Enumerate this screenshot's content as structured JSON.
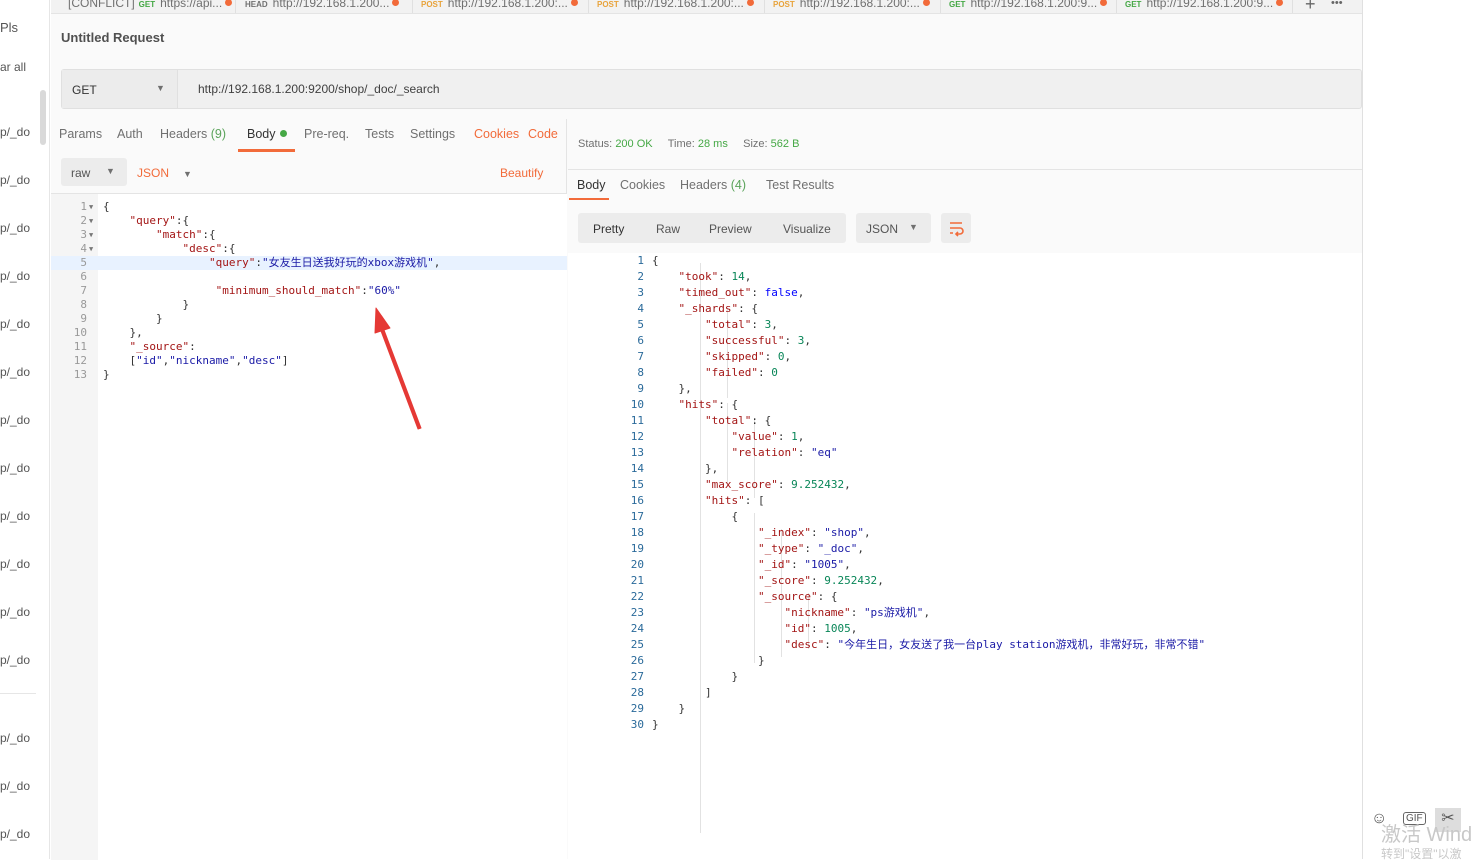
{
  "sidebar": {
    "top_text": "Pls",
    "clear_all": "ar all",
    "items": [
      "p/_do",
      "p/_do",
      "p/_do",
      "p/_do",
      "p/_do",
      "p/_do",
      "p/_do",
      "p/_do",
      "p/_do",
      "p/_do",
      "p/_do",
      "p/_do",
      "p/_do",
      "p/_do",
      "p/_do"
    ]
  },
  "tabs": [
    {
      "prefix": "[CONFLICT]",
      "method": "GET",
      "method_color": "#45a845",
      "label": "https://api..."
    },
    {
      "method": "HEAD",
      "method_color": "#707070",
      "label": "http://192.168.1.200..."
    },
    {
      "method": "POST",
      "method_color": "#e8a33b",
      "label": "http://192.168.1.200:..."
    },
    {
      "method": "POST",
      "method_color": "#e8a33b",
      "label": "http://192.168.1.200:..."
    },
    {
      "method": "POST",
      "method_color": "#e8a33b",
      "label": "http://192.168.1.200:..."
    },
    {
      "method": "GET",
      "method_color": "#45a845",
      "label": "http://192.168.1.200:9..."
    },
    {
      "method": "GET",
      "method_color": "#45a845",
      "label": "http://192.168.1.200:9..."
    }
  ],
  "tab_actions": {
    "add": "+",
    "more": "•••"
  },
  "request": {
    "title": "Untitled Request",
    "method": "GET",
    "url": "http://192.168.1.200:9200/shop/_doc/_search",
    "tabs": {
      "params": "Params",
      "auth": "Auth",
      "headers": "Headers",
      "headers_count": "(9)",
      "body": "Body",
      "prereq": "Pre-req.",
      "tests": "Tests",
      "settings": "Settings",
      "cookies": "Cookies",
      "code": "Code"
    },
    "body_mode": "raw",
    "body_format": "JSON",
    "beautify": "Beautify",
    "lines": [
      "{",
      "    \"query\":{",
      "        \"match\":{",
      "            \"desc\":{",
      "                \"query\":\"女友生日送我好玩的xbox游戏机\",",
      "",
      "                 \"minimum_should_match\":\"60%\"",
      "            }",
      "        }",
      "    },",
      "    \"_source\":",
      "    [\"id\",\"nickname\",\"desc\"]",
      "}"
    ]
  },
  "response": {
    "status_label": "Status:",
    "status_value": "200 OK",
    "time_label": "Time:",
    "time_value": "28 ms",
    "size_label": "Size:",
    "size_value": "562 B",
    "tabs": {
      "body": "Body",
      "cookies": "Cookies",
      "headers": "Headers",
      "headers_count": "(4)",
      "test_results": "Test Results"
    },
    "views": {
      "pretty": "Pretty",
      "raw": "Raw",
      "preview": "Preview",
      "visualize": "Visualize"
    },
    "format": "JSON",
    "lines": [
      "{",
      "    \"took\": 14,",
      "    \"timed_out\": false,",
      "    \"_shards\": {",
      "        \"total\": 3,",
      "        \"successful\": 3,",
      "        \"skipped\": 0,",
      "        \"failed\": 0",
      "    },",
      "    \"hits\": {",
      "        \"total\": {",
      "            \"value\": 1,",
      "            \"relation\": \"eq\"",
      "        },",
      "        \"max_score\": 9.252432,",
      "        \"hits\": [",
      "            {",
      "                \"_index\": \"shop\",",
      "                \"_type\": \"_doc\",",
      "                \"_id\": \"1005\",",
      "                \"_score\": 9.252432,",
      "                \"_source\": {",
      "                    \"nickname\": \"ps游戏机\",",
      "                    \"id\": 1005,",
      "                    \"desc\": \"今年生日，女友送了我一台play station游戏机，非常好玩，非常不错\"",
      "                }",
      "            }",
      "        ]",
      "    }",
      "}"
    ]
  },
  "overlay": {
    "watermark_1": "激活 Wind",
    "watermark_2": "转到\"设置\"以激",
    "gif_label": "GIF"
  },
  "colors": {
    "accent": "#f26b3a",
    "ok": "#45a845"
  }
}
